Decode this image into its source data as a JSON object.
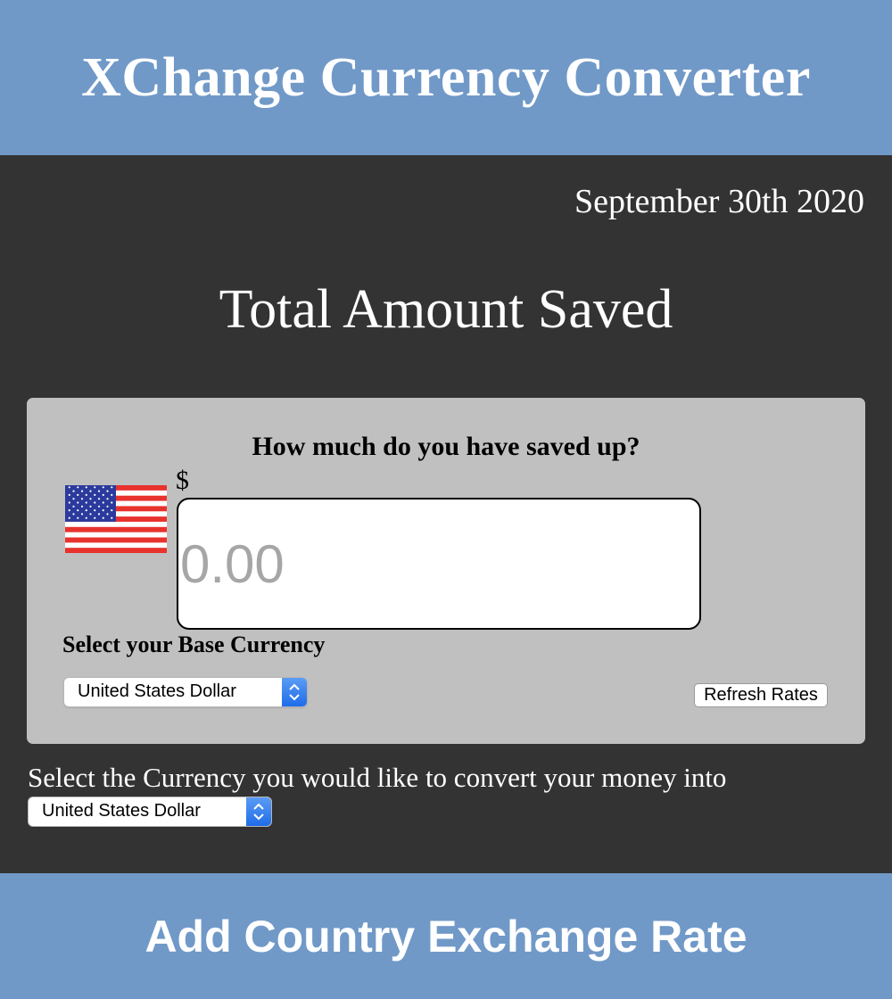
{
  "header": {
    "title": "XChange Currency Converter",
    "background_color": "#7099c8"
  },
  "date": "September 30th 2020",
  "main": {
    "title": "Total Amount Saved",
    "background_color": "#333333"
  },
  "savings_card": {
    "question": "How much do you have saved up?",
    "flag_icon": "us-flag-icon",
    "currency_symbol": "$",
    "amount_input": {
      "value": "",
      "placeholder": "0.00"
    },
    "base_currency_label": "Select your Base Currency",
    "base_currency_select": {
      "selected": "United States Dollar"
    },
    "refresh_button_label": "Refresh Rates",
    "background_color": "#c0c0c0"
  },
  "convert": {
    "label": "Select the Currency you would like to convert your money into",
    "target_currency_select": {
      "selected": "United States Dollar"
    }
  },
  "footer": {
    "title": "Add Country Exchange Rate"
  }
}
